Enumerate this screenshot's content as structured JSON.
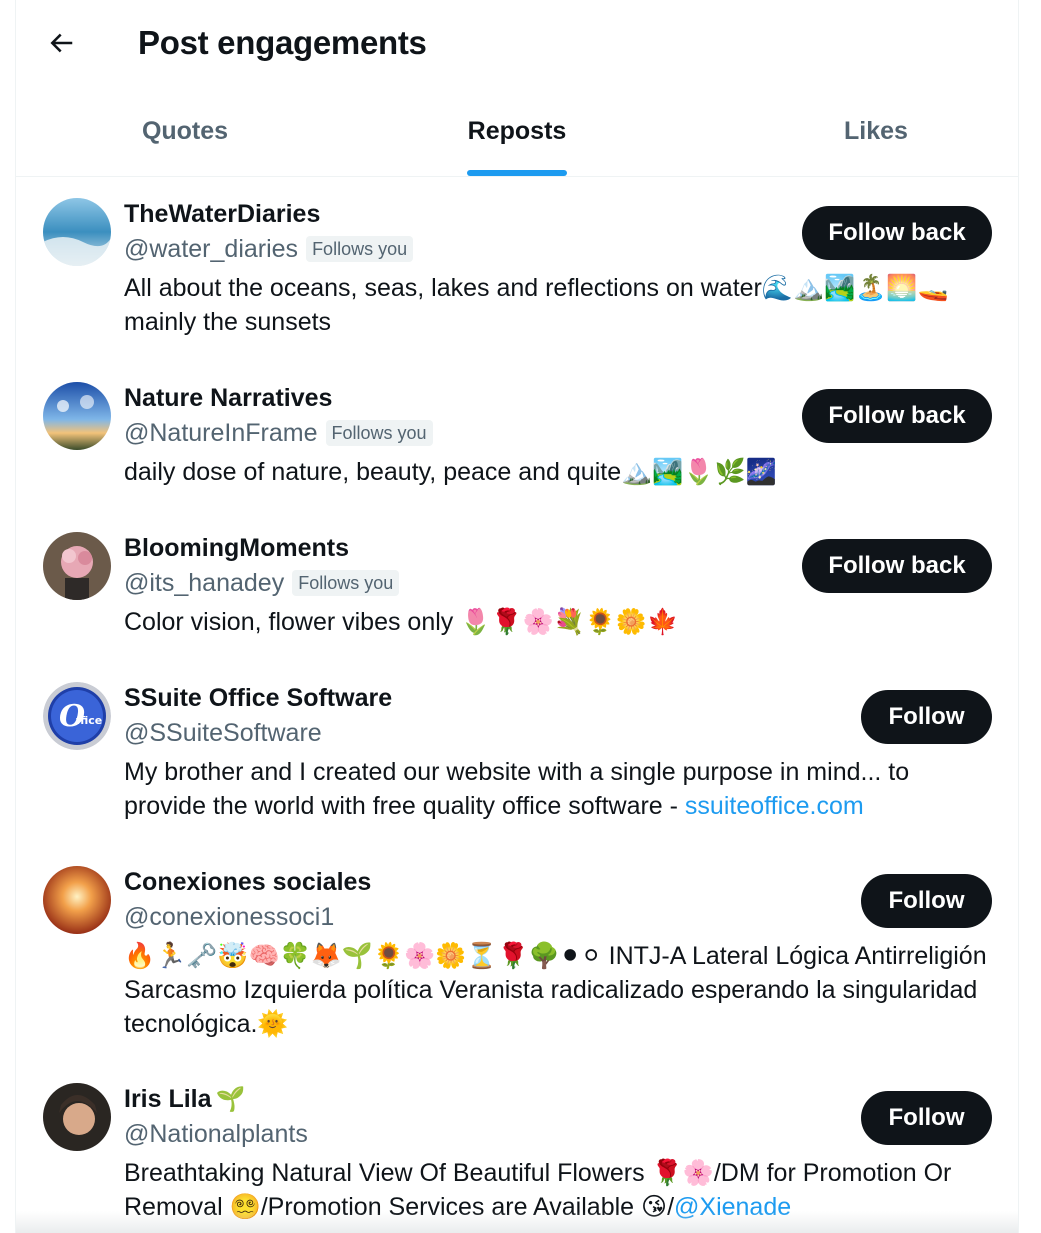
{
  "header": {
    "title": "Post engagements"
  },
  "tabs": [
    {
      "label": "Quotes",
      "active": false
    },
    {
      "label": "Reposts",
      "active": true
    },
    {
      "label": "Likes",
      "active": false
    }
  ],
  "users": [
    {
      "name": "TheWaterDiaries",
      "handle": "@water_diaries",
      "badge": "Follows you",
      "bio": "All about the oceans, seas, lakes and reflections on water🌊🏔️🏞️🏝️🌅🚤 mainly the sunsets",
      "button": "Follow back"
    },
    {
      "name": "Nature Narratives",
      "handle": "@NatureInFrame",
      "badge": "Follows you",
      "bio": "daily dose of nature, beauty, peace and quite🏔️🏞️🌷🌿🌌",
      "button": "Follow back"
    },
    {
      "name": "BloomingMoments",
      "handle": "@its_hanadey",
      "badge": "Follows you",
      "bio": "Color vision, flower vibes only 🌷🌹🌸💐🌻🌼🍁",
      "button": "Follow back"
    },
    {
      "name": "SSuite Office Software",
      "handle": "@SSuiteSoftware",
      "bio": "My brother and I created our website with a single purpose in mind... to provide the world with free quality office software - ",
      "bio_link": "ssuiteoffice.com",
      "button": "Follow"
    },
    {
      "name": "Conexiones sociales",
      "handle": "@conexionessoci1",
      "bio": "🔥🏃🗝️🤯🧠🍀🦊🌱🌻🌸🌼⏳🌹🌳⚫⚪   INTJ-A Lateral Lógica Antirreligión Sarcasmo Izquierda política Veranista radicalizado esperando la singularidad tecnológica.🌞",
      "button": "Follow"
    },
    {
      "name": "Iris Lila",
      "name_emoji": "🌱",
      "handle": "@Nationalplants",
      "bio": "Breathtaking Natural View Of Beautiful Flowers 🌹🌸/DM for Promotion Or Removal 😵‍💫/Promotion Services are Available 😘/",
      "bio_link": "@Xienade",
      "button": "Follow"
    }
  ],
  "colors": {
    "accent": "#1d9bf0",
    "text": "#0f1419",
    "secondary": "#536471",
    "button_bg": "#0f1419"
  }
}
